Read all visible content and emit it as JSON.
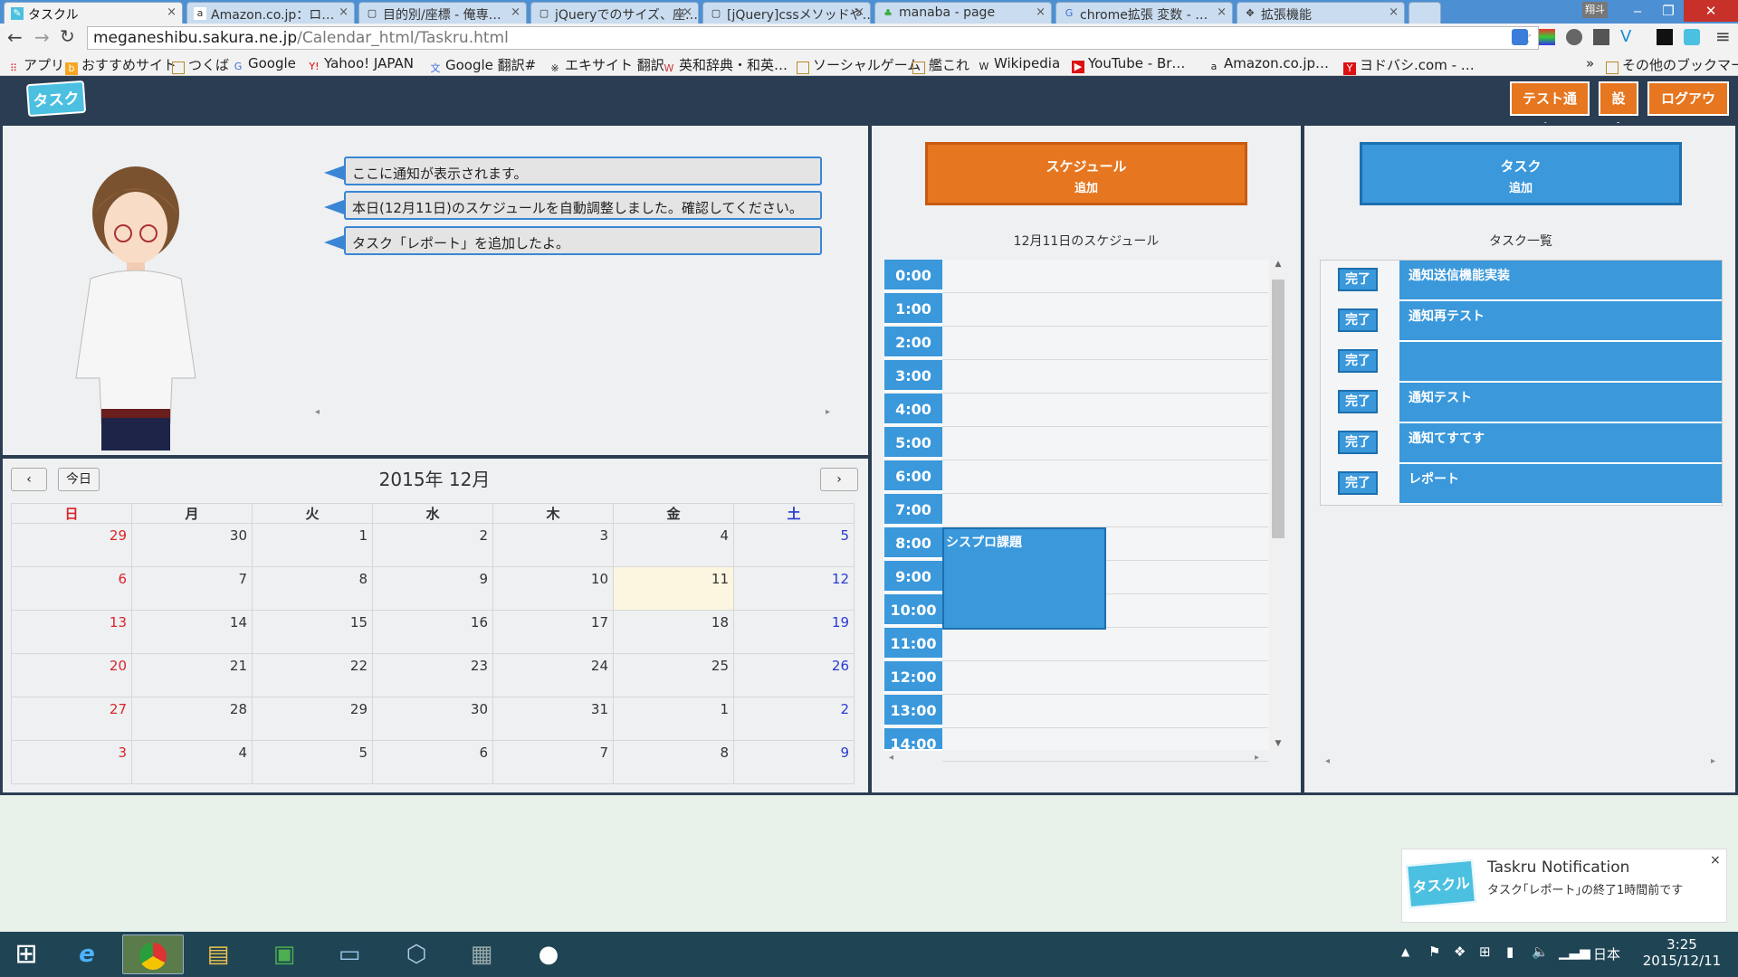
{
  "browser": {
    "tabs": [
      {
        "label": "タスクル",
        "icon": "app-favicon"
      },
      {
        "label": "Amazon.co.jp：ロ…",
        "icon": "amazon-icon"
      },
      {
        "label": "目的別/座標 - 俺専…",
        "icon": "page-icon"
      },
      {
        "label": "jQueryでのサイズ、座…",
        "icon": "page-icon"
      },
      {
        "label": "[jQuery]cssメソッドや…",
        "icon": "page-icon"
      },
      {
        "label": "manaba - page",
        "icon": "manaba-icon"
      },
      {
        "label": "chrome拡張 変数 - …",
        "icon": "google-icon"
      },
      {
        "label": "拡張機能",
        "icon": "puzzle-icon"
      }
    ],
    "profile_label": "翔斗",
    "url_host": "meganeshibu.sakura.ne.jp",
    "url_path": "/Calendar_html/Taskru.html",
    "bookmarks": [
      {
        "label": "アプリ",
        "icon": "apps-icon"
      },
      {
        "label": "おすすめサイト",
        "icon": "bing-icon"
      },
      {
        "label": "つくば",
        "icon": "folder-icon"
      },
      {
        "label": "Google",
        "icon": "google-icon"
      },
      {
        "label": "Yahoo! JAPAN",
        "icon": "yahoo-icon"
      },
      {
        "label": "Google 翻訳#",
        "icon": "translate-icon"
      },
      {
        "label": "エキサイト 翻訳",
        "icon": "excite-icon"
      },
      {
        "label": "英和辞典・和英…",
        "icon": "weblio-icon"
      },
      {
        "label": "ソーシャルゲーム",
        "icon": "folder-icon"
      },
      {
        "label": "艦これ",
        "icon": "folder-icon"
      },
      {
        "label": "Wikipedia",
        "icon": "wikipedia-icon"
      },
      {
        "label": "YouTube - Br…",
        "icon": "youtube-icon"
      },
      {
        "label": "Amazon.co.jp…",
        "icon": "amazon-icon"
      },
      {
        "label": "ヨドバシ.com - …",
        "icon": "yodobashi-icon"
      }
    ],
    "bookmarks_more": "»",
    "other_bookmarks": "その他のブックマーク"
  },
  "header": {
    "logo_text": "タスクル",
    "buttons": [
      "テスト通知",
      "設定",
      "ログアウト"
    ]
  },
  "notifications": [
    "ここに通知が表示されます。",
    "本日(12月11日)のスケジュールを自動調整しました。確認してください。",
    "タスク「レポート」を追加したよ。"
  ],
  "calendar": {
    "title": "2015年 12月",
    "today_label": "今日",
    "prev": "‹",
    "next": "›",
    "weekdays": [
      "日",
      "月",
      "火",
      "水",
      "木",
      "金",
      "土"
    ],
    "weeks": [
      [
        "29",
        "30",
        "1",
        "2",
        "3",
        "4",
        "5"
      ],
      [
        "6",
        "7",
        "8",
        "9",
        "10",
        "11",
        "12"
      ],
      [
        "13",
        "14",
        "15",
        "16",
        "17",
        "18",
        "19"
      ],
      [
        "20",
        "21",
        "22",
        "23",
        "24",
        "25",
        "26"
      ],
      [
        "27",
        "28",
        "29",
        "30",
        "31",
        "1",
        "2"
      ],
      [
        "3",
        "4",
        "5",
        "6",
        "7",
        "8",
        "9"
      ]
    ],
    "today_cell": "11"
  },
  "schedule": {
    "add_label": "スケジュール",
    "add_sub": "追加",
    "title": "12月11日のスケジュール",
    "hours": [
      "0:00",
      "1:00",
      "2:00",
      "3:00",
      "4:00",
      "5:00",
      "6:00",
      "7:00",
      "8:00",
      "9:00",
      "10:00",
      "11:00",
      "12:00",
      "13:00",
      "14:00"
    ],
    "events": [
      {
        "label": "シスプロ課題",
        "start": "8:00",
        "end": "11:00"
      }
    ]
  },
  "tasks": {
    "add_label": "タスク",
    "add_sub": "追加",
    "title": "タスク一覧",
    "done_label": "完了",
    "items": [
      "通知送信機能実装",
      "通知再テスト",
      "",
      "通知テスト",
      "通知てすてす",
      "レポート"
    ]
  },
  "toast": {
    "title": "Taskru Notification",
    "message": "タスク｢レポート｣の終了1時間前です",
    "close": "×"
  },
  "taskbar": {
    "ime": "日本",
    "time": "3:25",
    "date": "2015/12/11"
  },
  "colors": {
    "accent_orange": "#e6761f",
    "accent_blue": "#3a98db",
    "header_dark": "#2b3d52",
    "sunday_red": "#d9252a",
    "saturday_blue": "#2a3ad0"
  }
}
